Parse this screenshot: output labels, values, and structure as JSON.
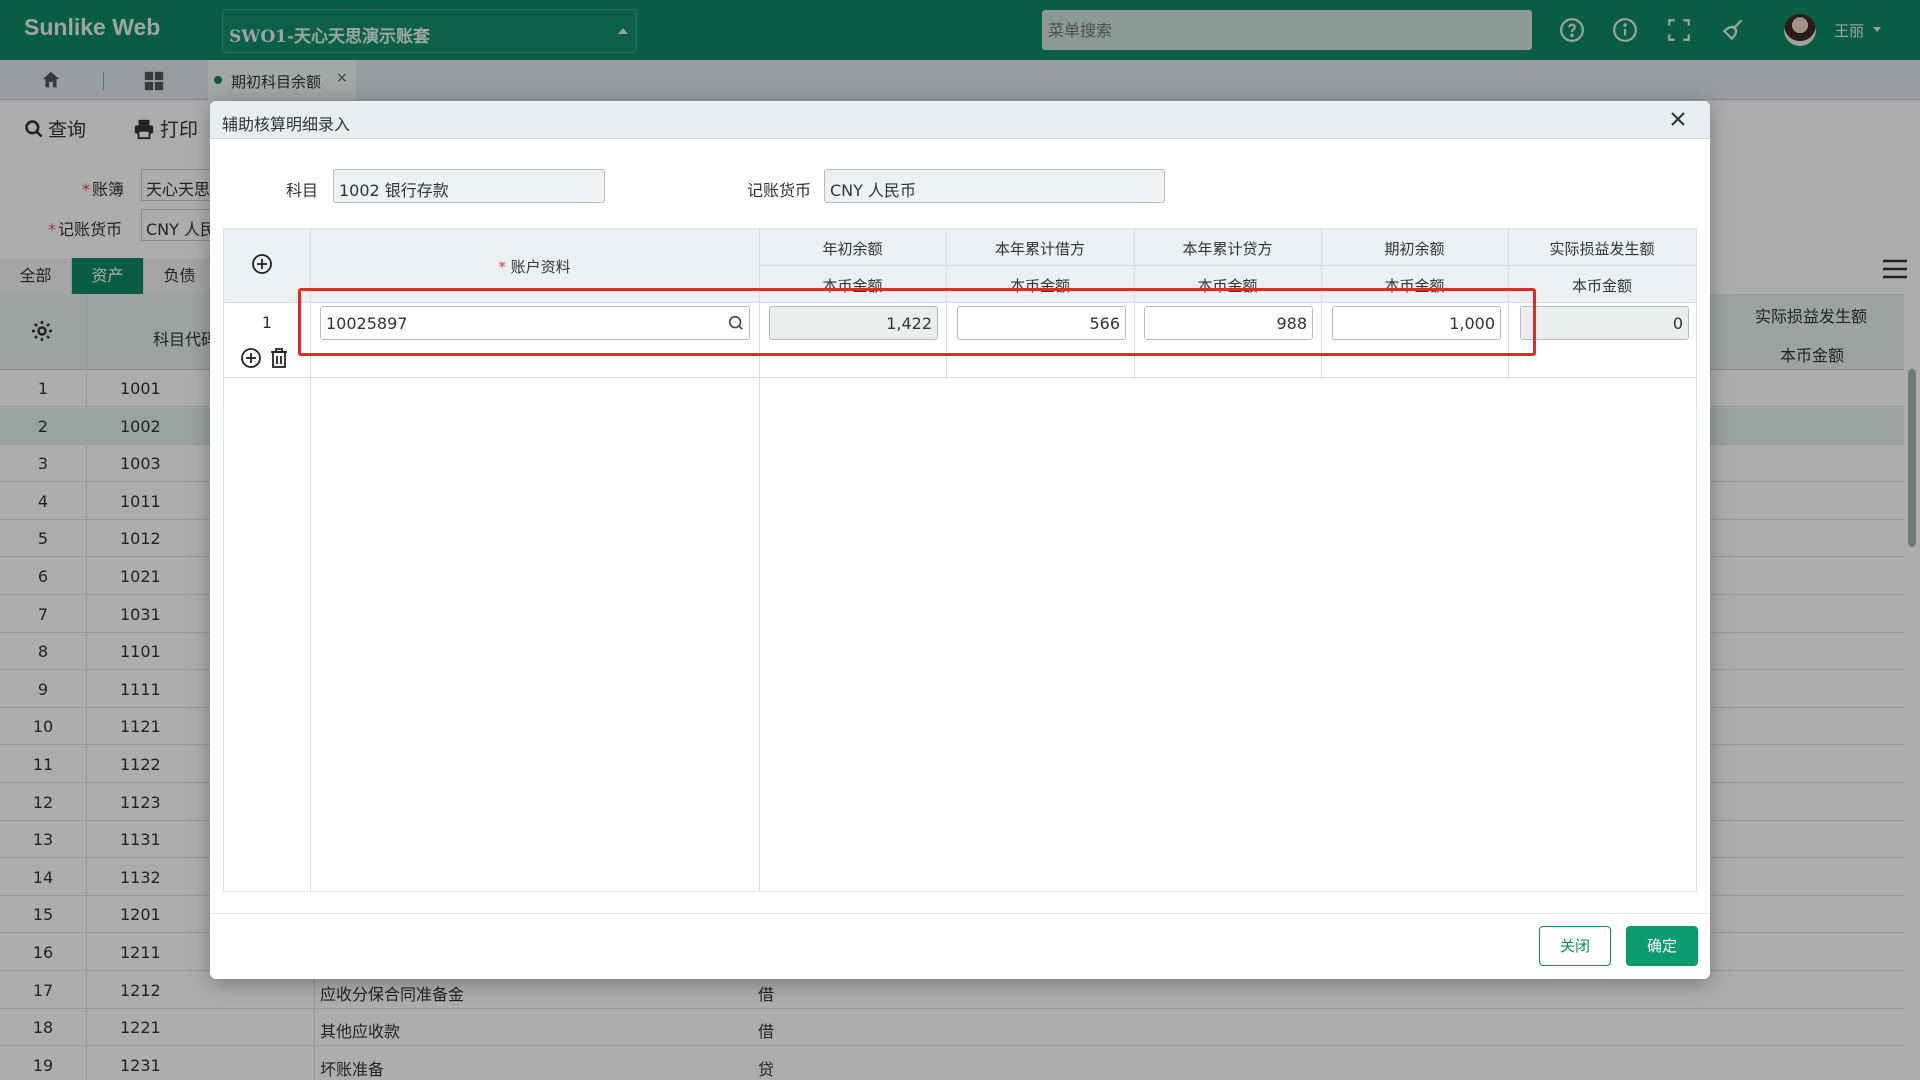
{
  "app": {
    "logo": "Sunlike Web",
    "ledger": "SWO1-天心天思演示账套",
    "menu_search_placeholder": "菜单搜索",
    "user": "王丽",
    "icons": [
      "help-icon",
      "info-icon",
      "fullscreen-icon",
      "clean-icon"
    ]
  },
  "tabs": {
    "active_label": "期初科目余额",
    "close": "×"
  },
  "toolbar": {
    "query_label": "查询",
    "print_label": "打印"
  },
  "filters": {
    "book_label": "账簿",
    "book_value": "天心天思",
    "currency_label": "记账货币",
    "currency_value": "CNY 人民"
  },
  "categories": [
    "全部",
    "资产",
    "负债"
  ],
  "bg_grid": {
    "code_header": "科目代码",
    "right_header_top": "实际损益发生额",
    "right_header_bottom": "本币金额",
    "rows": [
      {
        "n": "1",
        "code": "1001",
        "name": "",
        "dir": ""
      },
      {
        "n": "2",
        "code": "1002",
        "name": "",
        "dir": ""
      },
      {
        "n": "3",
        "code": "1003",
        "name": "",
        "dir": ""
      },
      {
        "n": "4",
        "code": "1011",
        "name": "",
        "dir": ""
      },
      {
        "n": "5",
        "code": "1012",
        "name": "",
        "dir": ""
      },
      {
        "n": "6",
        "code": "1021",
        "name": "",
        "dir": ""
      },
      {
        "n": "7",
        "code": "1031",
        "name": "",
        "dir": ""
      },
      {
        "n": "8",
        "code": "1101",
        "name": "",
        "dir": ""
      },
      {
        "n": "9",
        "code": "1111",
        "name": "",
        "dir": ""
      },
      {
        "n": "10",
        "code": "1121",
        "name": "",
        "dir": ""
      },
      {
        "n": "11",
        "code": "1122",
        "name": "",
        "dir": ""
      },
      {
        "n": "12",
        "code": "1123",
        "name": "",
        "dir": ""
      },
      {
        "n": "13",
        "code": "1131",
        "name": "",
        "dir": ""
      },
      {
        "n": "14",
        "code": "1132",
        "name": "",
        "dir": ""
      },
      {
        "n": "15",
        "code": "1201",
        "name": "",
        "dir": ""
      },
      {
        "n": "16",
        "code": "1211",
        "name": "",
        "dir": ""
      },
      {
        "n": "17",
        "code": "1212",
        "name": "应收分保合同准备金",
        "dir": "借"
      },
      {
        "n": "18",
        "code": "1221",
        "name": "其他应收款",
        "dir": "借"
      },
      {
        "n": "19",
        "code": "1231",
        "name": "坏账准备",
        "dir": "贷"
      }
    ]
  },
  "dialog": {
    "title": "辅助核算明细录入",
    "subject_label": "科目",
    "subject_value": "1002 银行存款",
    "currency_label": "记账货币",
    "currency_value": "CNY 人民币",
    "columns": {
      "account": "账户资料",
      "year_begin": "年初余额",
      "debit": "本年累计借方",
      "credit": "本年累计贷方",
      "opening": "期初余额",
      "actual_pl": "实际损益发生额",
      "sub": "本币金额"
    },
    "row": {
      "n": "1",
      "account": "10025897",
      "year_begin": "1,422",
      "debit": "566",
      "credit": "988",
      "opening": "1,000",
      "actual_pl": "0"
    },
    "close_label": "关闭",
    "ok_label": "确定"
  },
  "colors": {
    "brand": "#0d8a62",
    "highlight": "#e02a2a"
  }
}
